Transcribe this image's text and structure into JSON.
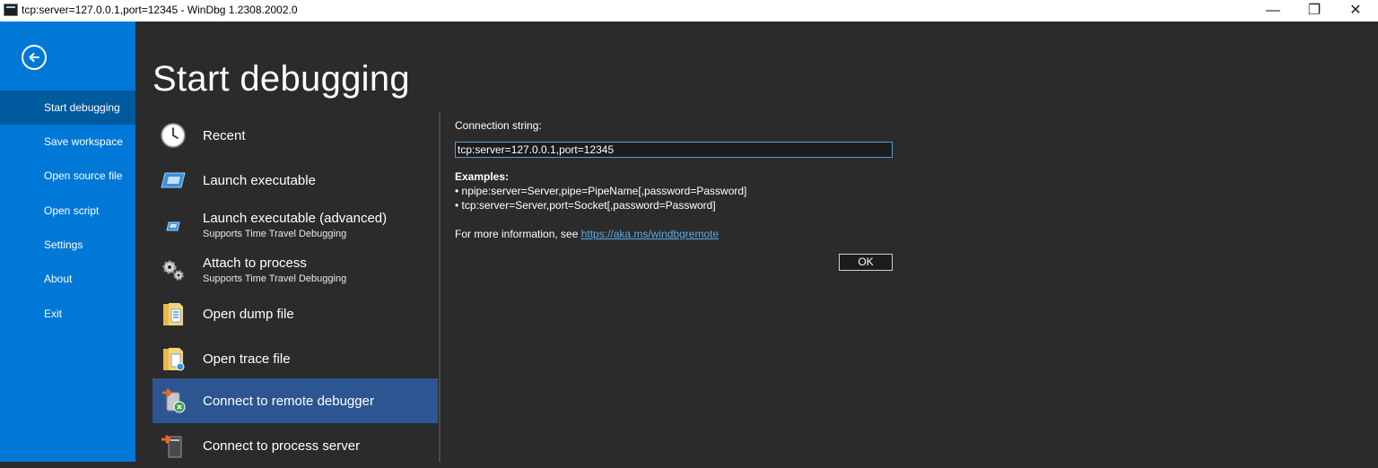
{
  "window": {
    "title": "tcp:server=127.0.0.1,port=12345 - WinDbg 1.2308.2002.0",
    "minimize_glyph": "—",
    "restore_glyph": "❐",
    "close_glyph": "✕"
  },
  "nav": {
    "back_icon": "back-arrow-circle-icon",
    "items": [
      {
        "label": "Start debugging",
        "active": true
      },
      {
        "label": "Save workspace"
      },
      {
        "label": "Open source file"
      },
      {
        "label": "Open script"
      },
      {
        "label": "Settings"
      },
      {
        "label": "About"
      },
      {
        "label": "Exit"
      }
    ]
  },
  "main": {
    "title": "Start debugging",
    "options": [
      {
        "label": "Recent",
        "icon": "clock-icon"
      },
      {
        "label": "Launch executable",
        "icon": "window-icon"
      },
      {
        "label": "Launch executable (advanced)",
        "sublabel": "Supports Time Travel Debugging",
        "icon": "window-small-icon"
      },
      {
        "label": "Attach to process",
        "sublabel": "Supports Time Travel Debugging",
        "icon": "gears-icon"
      },
      {
        "label": "Open dump file",
        "icon": "folder-document-icon"
      },
      {
        "label": "Open trace file",
        "icon": "folder-trace-icon"
      },
      {
        "label": "Connect to remote debugger",
        "icon": "remote-debugger-icon",
        "active": true
      },
      {
        "label": "Connect to process server",
        "icon": "process-server-icon"
      }
    ]
  },
  "panel": {
    "connection_label": "Connection string:",
    "connection_value": "tcp:server=127.0.0.1,port=12345",
    "examples_title": "Examples:",
    "examples": [
      "• npipe:server=Server,pipe=PipeName[,password=Password]",
      "• tcp:server=Server,port=Socket[,password=Password]"
    ],
    "more_info_text": "For more information, see ",
    "more_info_link": "https://aka.ms/windbgremote",
    "ok_label": "OK"
  },
  "colors": {
    "nav_bg": "#0078d7",
    "nav_active": "#005a9e",
    "main_bg": "#2b2b2b",
    "option_active": "#2d5591",
    "link": "#5aa9e6"
  }
}
